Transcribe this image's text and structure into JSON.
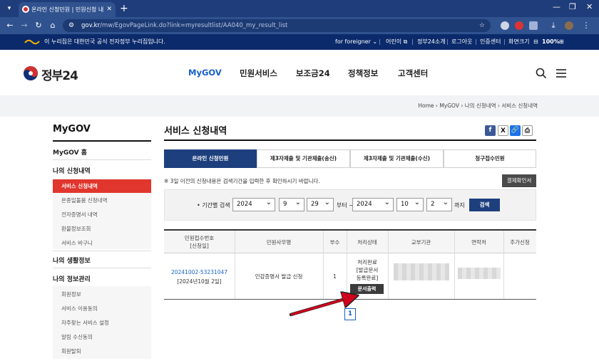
{
  "browser": {
    "tab_title": "온라인 신청민원 | 민원신청 내",
    "url_host": "gov.kr",
    "url_path": "/mw/EgovPageLink.do?link=myresultlist/AA040_my_result_list"
  },
  "gov_banner": {
    "message": "이 누리집은 대한민국 공식 전자정부 누리집입니다.",
    "foreigner": "for foreigner",
    "kids": "어린이",
    "about": "정부24소개",
    "logout": "로그아웃",
    "cert_center": "인증센터",
    "screen_size": "화면크기",
    "zoom": "100%"
  },
  "header": {
    "logo": "정부24",
    "nav": [
      "MyGOV",
      "민원서비스",
      "보조금24",
      "정책정보",
      "고객센터"
    ]
  },
  "breadcrumb": [
    "Home",
    "MyGOV",
    "나의 신청내역",
    "서비스 신청내역"
  ],
  "sidebar": {
    "title": "MyGOV",
    "home": "MyGOV 홈",
    "section1": "나의 신청내역",
    "section1_items": [
      "서비스 신청내역",
      "온종일돌봄 신청내역",
      "전자증명서 내역",
      "환불정보조회",
      "서비스 바구니"
    ],
    "section2": "나의 생활정보",
    "section3": "나의 정보관리",
    "section3_items": [
      "회원정보",
      "서비스 이용동의",
      "자주찾는 서비스 설정",
      "알림 수신동의",
      "회원탈퇴"
    ]
  },
  "main": {
    "title": "서비스 신청내역",
    "tabs": [
      "온라인 신청민원",
      "제3자제출 및 기관제출(송신)",
      "제3자제출 및 기관제출(수신)",
      "청구접수민원"
    ],
    "notice": "※ 3일 이전의 신청내용은 검색기간을 입력한 후 확인하시기 바랍니다.",
    "verify_button": "결제확인서",
    "search": {
      "label": "• 기간별 검색",
      "from_year": "2024",
      "from_month": "9",
      "from_day": "29",
      "from_suffix": "부터 ~",
      "to_year": "2024",
      "to_month": "10",
      "to_day": "2",
      "to_suffix": "까지",
      "button": "검색"
    },
    "table": {
      "headers": [
        "민원접수번호\n[신청일]",
        "민원사무명",
        "부수",
        "처리상태",
        "교부기관",
        "연락처",
        "추가신청"
      ],
      "row": {
        "receipt_no": "20241002-53231047",
        "date": "[2024년10월 2일]",
        "name": "인감증명서 발급 신청",
        "count": "1",
        "status": "처리완료\n[발급문서\n등록완료]",
        "print_button": "문서출력"
      }
    },
    "page": "1"
  }
}
